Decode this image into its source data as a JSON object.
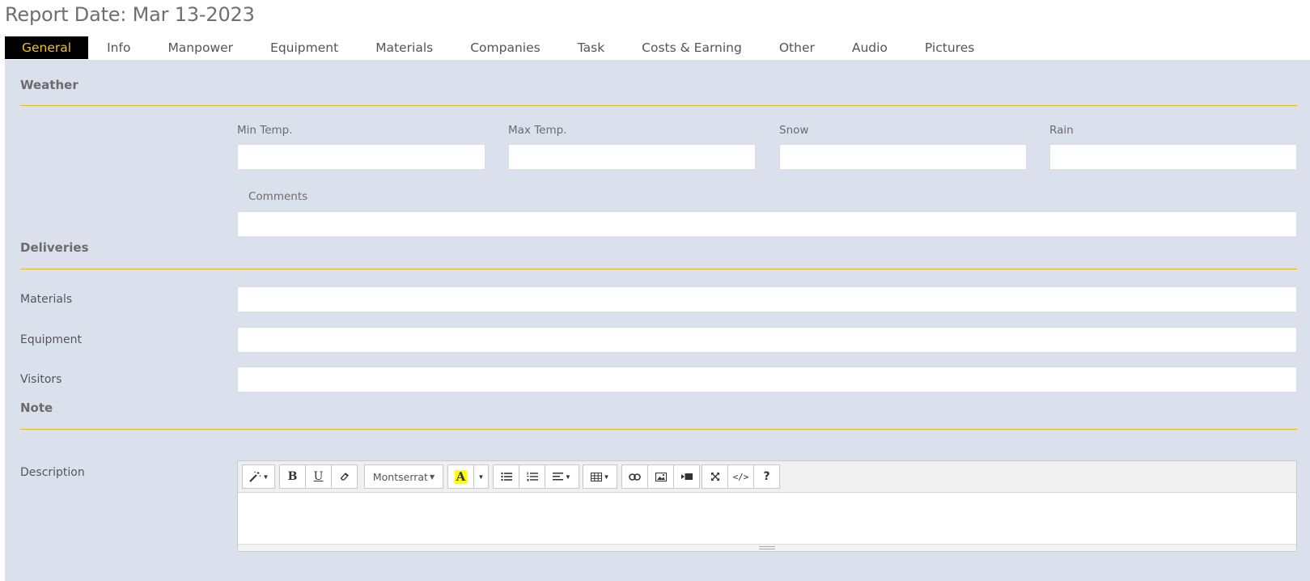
{
  "header": {
    "title": "Report Date: Mar 13-2023"
  },
  "tabs": [
    {
      "label": "General",
      "active": true
    },
    {
      "label": "Info"
    },
    {
      "label": "Manpower"
    },
    {
      "label": "Equipment"
    },
    {
      "label": "Materials"
    },
    {
      "label": "Companies"
    },
    {
      "label": "Task"
    },
    {
      "label": "Costs & Earning"
    },
    {
      "label": "Other"
    },
    {
      "label": "Audio"
    },
    {
      "label": "Pictures"
    }
  ],
  "weather": {
    "title": "Weather",
    "min_temp": {
      "label": "Min Temp.",
      "value": ""
    },
    "max_temp": {
      "label": "Max Temp.",
      "value": ""
    },
    "snow": {
      "label": "Snow",
      "value": ""
    },
    "rain": {
      "label": "Rain",
      "value": ""
    },
    "comments": {
      "label": "Comments",
      "value": ""
    }
  },
  "deliveries": {
    "title": "Deliveries",
    "materials": {
      "label": "Materials",
      "value": ""
    },
    "equipment": {
      "label": "Equipment",
      "value": ""
    },
    "visitors": {
      "label": "Visitors",
      "value": ""
    }
  },
  "note": {
    "title": "Note",
    "description": {
      "label": "Description",
      "value": ""
    },
    "toolbar": {
      "font_name": "Montserrat",
      "bold_glyph": "B",
      "underline_glyph": "U",
      "color_glyph": "A",
      "help_glyph": "?",
      "code_glyph": "</>"
    }
  },
  "colors": {
    "accent": "#f2c21b",
    "panel_bg": "#dbe1ec",
    "rule": "#e1b920"
  }
}
